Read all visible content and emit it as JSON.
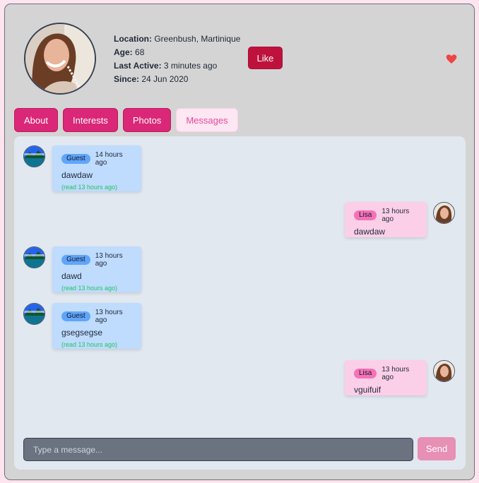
{
  "profile": {
    "location_label": "Location:",
    "location_value": "Greenbush, Martinique",
    "age_label": "Age:",
    "age_value": "68",
    "last_active_label": "Last Active:",
    "last_active_value": "3 minutes ago",
    "since_label": "Since:",
    "since_value": "24 Jun 2020",
    "like_label": "Like"
  },
  "tabs": [
    {
      "label": "About"
    },
    {
      "label": "Interests"
    },
    {
      "label": "Photos"
    },
    {
      "label": "Messages",
      "active": true
    }
  ],
  "messages": [
    {
      "author": "Guest",
      "time": "14 hours ago",
      "text": "dawdaw",
      "read": "(read 13 hours ago)"
    },
    {
      "author": "Lisa",
      "time": "13 hours ago",
      "text": "dawdaw"
    },
    {
      "author": "Guest",
      "time": "13 hours ago",
      "text": "dawd",
      "read": "(read 13 hours ago)"
    },
    {
      "author": "Guest",
      "time": "13 hours ago",
      "text": "gsegsegse",
      "read": "(read 13 hours ago)"
    },
    {
      "author": "Lisa",
      "time": "13 hours ago",
      "text": "vguifuif"
    }
  ],
  "composer": {
    "placeholder": "Type a message...",
    "send_label": "Send"
  },
  "colors": {
    "accent": "#db2777",
    "like": "#be123c",
    "guest_bubble": "#bfdbfe",
    "own_bubble": "#fbcfe8",
    "read_text": "#22c55e"
  },
  "icons": {
    "favorite": "heart-icon"
  }
}
